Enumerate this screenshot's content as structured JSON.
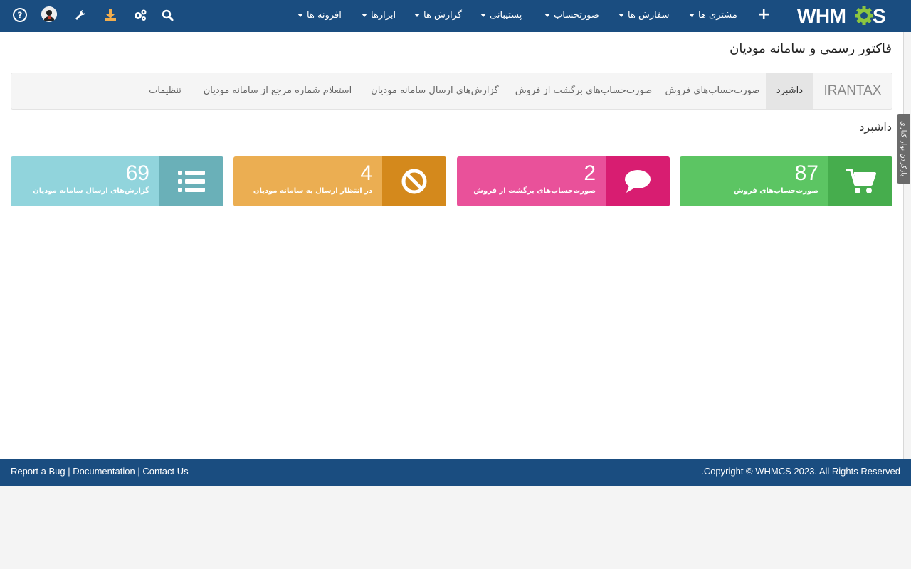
{
  "header": {
    "logo_text": "WHMCS",
    "nav": [
      {
        "label": "مشتری ها"
      },
      {
        "label": "سفارش ها"
      },
      {
        "label": "صورتحساب"
      },
      {
        "label": "پشتیبانی"
      },
      {
        "label": "گزارش ها"
      },
      {
        "label": "ابزارها"
      },
      {
        "label": "افزونه ها"
      }
    ],
    "tool_icons": [
      "search-icon",
      "gear-icon",
      "download-icon",
      "wrench-icon",
      "avatar",
      "help-icon"
    ],
    "color": "#1a4d80"
  },
  "page": {
    "title": "فاکتور رسمی و سامانه مودیان",
    "section_title": "داشبرد"
  },
  "tabs": [
    {
      "label": "IRANTAX"
    },
    {
      "label": "داشبرد",
      "active": true
    },
    {
      "label": "صورت‌حساب‌های فروش"
    },
    {
      "label": "صورت‌حساب‌های برگشت از فروش"
    },
    {
      "label": "گزارش‌های ارسال سامانه مودیان"
    },
    {
      "label": "استعلام شماره مرجع از سامانه مودیان"
    },
    {
      "label": "تنظیمات"
    }
  ],
  "cards": [
    {
      "count": "87",
      "label": "صورت‌حساب‌های فروش",
      "icon": "cart-icon",
      "color": "#5cc563",
      "icon_bg": "#46ad4d"
    },
    {
      "count": "2",
      "label": "صورت‌حساب‌های برگشت از فروش",
      "icon": "comment-icon",
      "color": "#e9519a",
      "icon_bg": "#d81d71"
    },
    {
      "count": "4",
      "label": "در انتظار ارسال به سامانه مودیان",
      "icon": "ban-icon",
      "color": "#ebae52",
      "icon_bg": "#d4891c"
    },
    {
      "count": "69",
      "label": "گزارش‌های ارسال سامانه مودیان",
      "icon": "list-icon",
      "color": "#91d4dc",
      "icon_bg": "#6ab0b8"
    }
  ],
  "side_tab": {
    "label": "بازکردن نوار کناری"
  },
  "footer": {
    "links": [
      "Report a Bug",
      "Documentation",
      "Contact Us"
    ],
    "separator": "|",
    "copyright": "Copyright © WHMCS 2023. All Rights Reserved."
  }
}
